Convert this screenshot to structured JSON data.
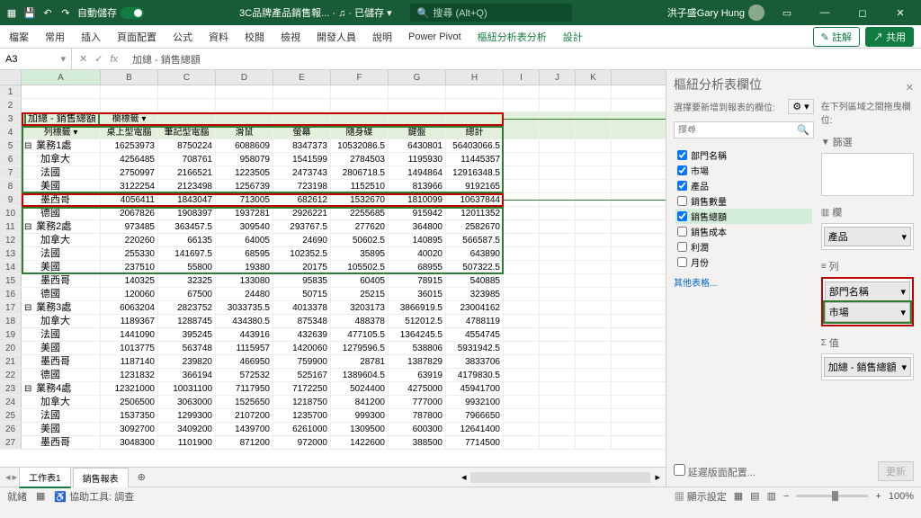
{
  "titlebar": {
    "autosave_label": "自動儲存",
    "doc_name": "3C品牌產品銷售報...",
    "saved": "已儲存",
    "search_placeholder": "搜尋 (Alt+Q)",
    "user": "洪子盛Gary Hung"
  },
  "ribbon": {
    "tabs": [
      "檔案",
      "常用",
      "插入",
      "頁面配置",
      "公式",
      "資料",
      "校閱",
      "檢視",
      "開發人員",
      "說明",
      "Power Pivot",
      "樞紐分析表分析",
      "設計"
    ],
    "comment": "註解",
    "share": "共用"
  },
  "namebox": "A3",
  "formula": "加總 - 銷售總額",
  "cols": [
    "A",
    "B",
    "C",
    "D",
    "E",
    "F",
    "G",
    "H",
    "I",
    "J",
    "K"
  ],
  "pivot": {
    "measure": "加總 - 銷售總額",
    "col_label": "欄標籤",
    "row_label": "列標籤",
    "col_headers": [
      "桌上型電腦",
      "筆記型電腦",
      "滑鼠",
      "螢幕",
      "隨身碟",
      "鍵盤",
      "總計"
    ],
    "rows": [
      {
        "n": 5,
        "l": 1,
        "label": "業務1處",
        "v": [
          "16253973",
          "8750224",
          "6088609",
          "8347373",
          "10532086.5",
          "6430801",
          "56403066.5"
        ]
      },
      {
        "n": 6,
        "l": 2,
        "label": "加拿大",
        "v": [
          "4256485",
          "708761",
          "958079",
          "1541599",
          "2784503",
          "1195930",
          "11445357"
        ]
      },
      {
        "n": 7,
        "l": 2,
        "label": "法國",
        "v": [
          "2750997",
          "2166521",
          "1223505",
          "2473743",
          "2806718.5",
          "1494864",
          "12916348.5"
        ]
      },
      {
        "n": 8,
        "l": 2,
        "label": "美國",
        "v": [
          "3122254",
          "2123498",
          "1256739",
          "723198",
          "1152510",
          "813966",
          "9192165"
        ]
      },
      {
        "n": 9,
        "l": 2,
        "label": "墨西哥",
        "v": [
          "4056411",
          "1843047",
          "713005",
          "682612",
          "1532670",
          "1810099",
          "10637844"
        ]
      },
      {
        "n": 10,
        "l": 2,
        "label": "德國",
        "v": [
          "2067826",
          "1908397",
          "1937281",
          "2926221",
          "2255685",
          "915942",
          "12011352"
        ]
      },
      {
        "n": 11,
        "l": 1,
        "label": "業務2處",
        "v": [
          "973485",
          "363457.5",
          "309540",
          "293767.5",
          "277620",
          "364800",
          "2582670"
        ]
      },
      {
        "n": 12,
        "l": 2,
        "label": "加拿大",
        "v": [
          "220260",
          "66135",
          "64005",
          "24690",
          "50602.5",
          "140895",
          "566587.5"
        ]
      },
      {
        "n": 13,
        "l": 2,
        "label": "法國",
        "v": [
          "255330",
          "141697.5",
          "68595",
          "102352.5",
          "35895",
          "40020",
          "643890"
        ]
      },
      {
        "n": 14,
        "l": 2,
        "label": "美國",
        "v": [
          "237510",
          "55800",
          "19380",
          "20175",
          "105502.5",
          "68955",
          "507322.5"
        ]
      },
      {
        "n": 15,
        "l": 2,
        "label": "墨西哥",
        "v": [
          "140325",
          "32325",
          "133080",
          "95835",
          "60405",
          "78915",
          "540885"
        ]
      },
      {
        "n": 16,
        "l": 2,
        "label": "德國",
        "v": [
          "120060",
          "67500",
          "24480",
          "50715",
          "25215",
          "36015",
          "323985"
        ]
      },
      {
        "n": 17,
        "l": 1,
        "label": "業務3處",
        "v": [
          "6063204",
          "2823752",
          "3033735.5",
          "4013378",
          "3203173",
          "3866919.5",
          "23004162"
        ]
      },
      {
        "n": 18,
        "l": 2,
        "label": "加拿大",
        "v": [
          "1189367",
          "1288745",
          "434380.5",
          "875348",
          "488378",
          "512012.5",
          "4788119"
        ]
      },
      {
        "n": 19,
        "l": 2,
        "label": "法國",
        "v": [
          "1441090",
          "395245",
          "443916",
          "432639",
          "477105.5",
          "1364245.5",
          "4554745"
        ]
      },
      {
        "n": 20,
        "l": 2,
        "label": "美國",
        "v": [
          "1013775",
          "563748",
          "1115957",
          "1420060",
          "1279596.5",
          "538806",
          "5931942.5"
        ]
      },
      {
        "n": 21,
        "l": 2,
        "label": "墨西哥",
        "v": [
          "1187140",
          "239820",
          "466950",
          "759900",
          "28781",
          "1387829",
          "3833706"
        ]
      },
      {
        "n": 22,
        "l": 2,
        "label": "德國",
        "v": [
          "1231832",
          "366194",
          "572532",
          "525167",
          "1389604.5",
          "63919",
          "4179830.5"
        ]
      },
      {
        "n": 23,
        "l": 1,
        "label": "業務4處",
        "v": [
          "12321000",
          "10031100",
          "7117950",
          "7172250",
          "5024400",
          "4275000",
          "45941700"
        ]
      },
      {
        "n": 24,
        "l": 2,
        "label": "加拿大",
        "v": [
          "2506500",
          "3063000",
          "1525650",
          "1218750",
          "841200",
          "777000",
          "9932100"
        ]
      },
      {
        "n": 25,
        "l": 2,
        "label": "法國",
        "v": [
          "1537350",
          "1299300",
          "2107200",
          "1235700",
          "999300",
          "787800",
          "7966650"
        ]
      },
      {
        "n": 26,
        "l": 2,
        "label": "美國",
        "v": [
          "3092700",
          "3409200",
          "1439700",
          "6261000",
          "1309500",
          "600300",
          "12641400"
        ]
      },
      {
        "n": 27,
        "l": 2,
        "label": "墨西哥",
        "v": [
          "3048300",
          "1101900",
          "871200",
          "972000",
          "1422600",
          "388500",
          "7714500"
        ]
      }
    ]
  },
  "fieldPane": {
    "title": "樞紐分析表欄位",
    "choose": "選擇要新增到報表的欄位:",
    "drag": "在下列區域之間拖曳欄位:",
    "search": "搜尋",
    "fields": [
      {
        "label": "部門名稱",
        "checked": true
      },
      {
        "label": "市場",
        "checked": true
      },
      {
        "label": "產品",
        "checked": true
      },
      {
        "label": "銷售數量",
        "checked": false
      },
      {
        "label": "銷售總額",
        "checked": true,
        "sel": true
      },
      {
        "label": "銷售成本",
        "checked": false
      },
      {
        "label": "利潤",
        "checked": false
      },
      {
        "label": "月份",
        "checked": false
      }
    ],
    "more": "其他表格...",
    "filters": "篩選",
    "columns": "欄",
    "rows": "列",
    "values": "值",
    "col_item": "產品",
    "row_items": [
      "部門名稱",
      "市場"
    ],
    "val_item": "加總 - 銷售總額",
    "defer": "延遲版面配置...",
    "update": "更新"
  },
  "sheets": {
    "tabs": [
      "工作表1",
      "銷售報表"
    ]
  },
  "status": {
    "ready": "就緒",
    "a11y": "協助工具: 調查",
    "display": "顯示設定",
    "zoom": "100%"
  },
  "chart_data": null
}
